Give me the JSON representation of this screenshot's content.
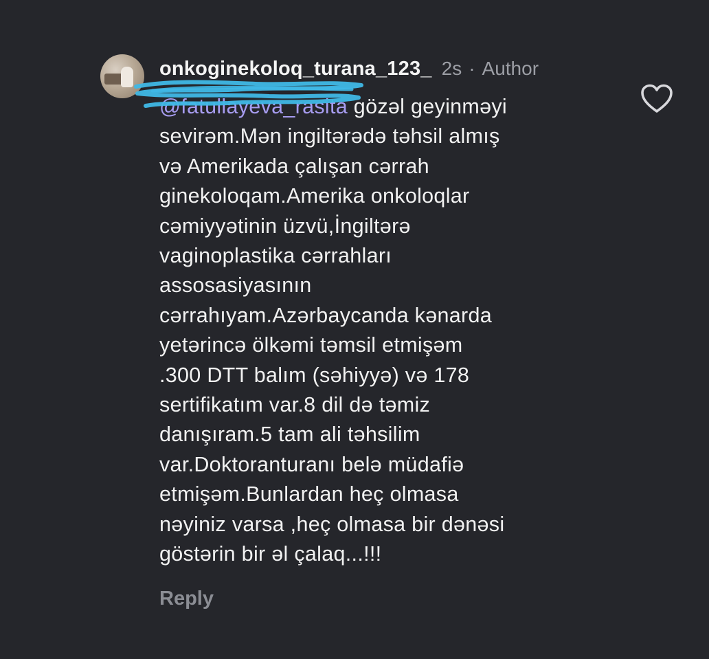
{
  "comment": {
    "username": "onkoginekoloq_turana_123_",
    "time": "2s",
    "separator": "·",
    "role": "Author",
    "mention": "@fatullayeva_rasita",
    "first_line_rest": " gözəl geyinməyi",
    "lines": [
      "sevirəm.Mən ingiltərədə təhsil almış",
      "və Amerikada çalışan cərrah",
      "ginekoloqam.Amerika onkoloqlar",
      "cəmiyyətinin üzvü,İngiltərə",
      "vaginoplastika cərrahları",
      "assosasiyasının",
      "cərrahıyam.Azərbaycanda kənarda",
      "yetərincə ölkəmi təmsil etmişəm",
      ".300 DTT balım (səhiyyə) və 178",
      "sertifikatım var.8 dil də təmiz",
      "danışıram.5 tam ali təhsilim",
      "var.Doktoranturanı belə müdafiə",
      "etmişəm.Bunlardan heç olmasa",
      "nəyiniz varsa ,heç olmasa bir dənəsi",
      "göstərin bir əl çalaq...!!!"
    ],
    "reply_label": "Reply",
    "icons": {
      "like": "heart-outline-icon",
      "avatar": "profile-avatar"
    },
    "colors": {
      "background": "#25262b",
      "mention": "#a79cf0",
      "meta": "#9c9ea5",
      "scribble": "#3fb8e6"
    }
  }
}
